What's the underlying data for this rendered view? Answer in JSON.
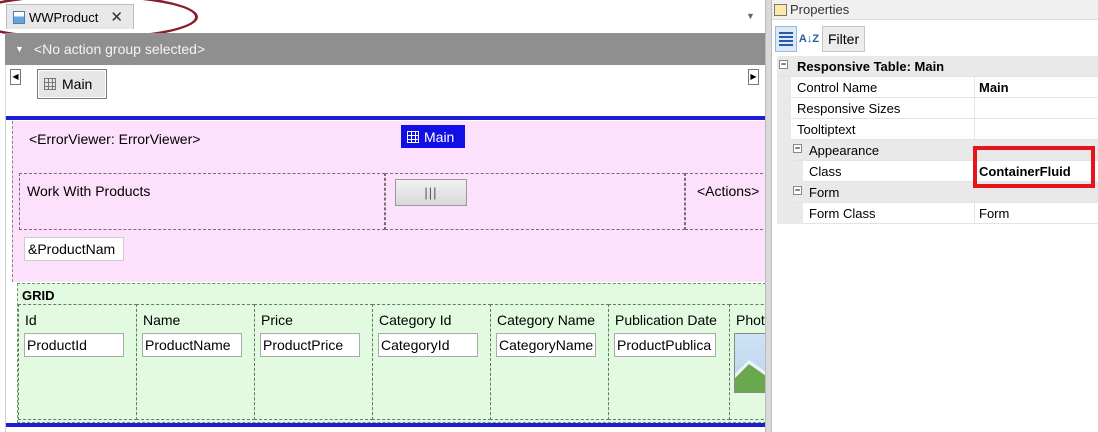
{
  "designer": {
    "tab_title": "WWProduct",
    "tab_close": "✕",
    "tab_dropdown": "▼",
    "action_group": "<No action group selected>",
    "action_group_arrow": "▼",
    "scroll_left": "◀",
    "scroll_right": "▶",
    "main_tab": "Main",
    "canvas": {
      "error_viewer": "<ErrorViewer: ErrorViewer>",
      "selected_table": "Main",
      "title_label": "Work With Products",
      "center_button": "|||",
      "actions_label": "<Actions>",
      "product_name_field": "&ProductNam",
      "grid": {
        "title": "GRID",
        "columns": [
          {
            "header": "Id",
            "field": "ProductId"
          },
          {
            "header": "Name",
            "field": "ProductName"
          },
          {
            "header": "Price",
            "field": "ProductPrice"
          },
          {
            "header": "Category Id",
            "field": "CategoryId"
          },
          {
            "header": "Category Name",
            "field": "CategoryName"
          },
          {
            "header": "Publication Date",
            "field": "ProductPublica"
          },
          {
            "header": "Photo",
            "field": ""
          }
        ]
      }
    }
  },
  "properties": {
    "title": "Properties",
    "filter_label": "Filter",
    "alpha_label": "A↓Z",
    "section": "Responsive Table: Main",
    "rows": {
      "control_name": {
        "name": "Control Name",
        "value": "Main"
      },
      "responsive_sizes": {
        "name": "Responsive Sizes",
        "value": ""
      },
      "tooltiptext": {
        "name": "Tooltiptext",
        "value": ""
      },
      "appearance": {
        "name": "Appearance"
      },
      "class": {
        "name": "Class",
        "value": "ContainerFluid"
      },
      "form": {
        "name": "Form"
      },
      "form_class": {
        "name": "Form Class",
        "value": "Form"
      }
    },
    "toggle_minus": "−"
  },
  "colors": {
    "selection_blue": "#0f0fe6",
    "pink_area": "#fde0fb",
    "grid_green": "#e2fbe0",
    "highlight_red": "#e8141c",
    "annotation_ellipse": "#8b1c2c"
  }
}
